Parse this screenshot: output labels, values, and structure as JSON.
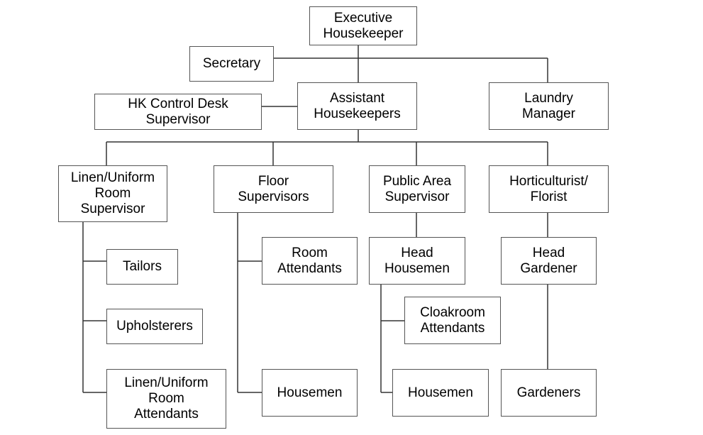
{
  "nodes": {
    "executive_housekeeper": "Executive\nHousekeeper",
    "secretary": "Secretary",
    "hk_control_desk": "HK Control Desk\nSupervisor",
    "assistant_housekeepers": "Assistant\nHousekeepers",
    "laundry_manager": "Laundry\nManager",
    "linen_supervisor": "Linen/Uniform\nRoom\nSupervisor",
    "floor_supervisors": "Floor\nSupervisors",
    "public_area_supervisor": "Public Area\nSupervisor",
    "horticulturist": "Horticulturist/\nFlorist",
    "tailors": "Tailors",
    "upholsterers": "Upholsterers",
    "linen_attendants": "Linen/Uniform\nRoom\nAttendants",
    "room_attendants": "Room\nAttendants",
    "floor_housemen": "Housemen",
    "head_housemen": "Head\nHousemen",
    "cloakroom_attendants": "Cloakroom\nAttendants",
    "public_housemen": "Housemen",
    "head_gardener": "Head\nGardener",
    "gardeners": "Gardeners"
  }
}
